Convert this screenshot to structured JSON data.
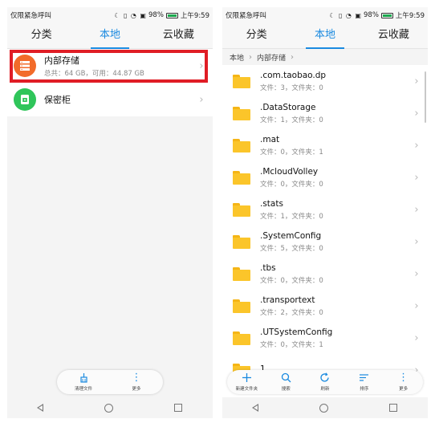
{
  "left_screen": {
    "status": {
      "carrier": "仅限紧急呼叫",
      "battery": "98%",
      "time": "上午9:59"
    },
    "tabs": [
      "分类",
      "本地",
      "云收藏"
    ],
    "storage": [
      {
        "name": "内部存储",
        "detail": "总共：64 GB，可用：44.87 GB",
        "icon": "storage-icon",
        "color": "#f26b2a"
      },
      {
        "name": "保密柜",
        "detail": "",
        "icon": "safe-icon",
        "color": "#2fc55a"
      }
    ],
    "toolbar": [
      {
        "label": "清理文件",
        "icon": "clean-icon"
      },
      {
        "label": "更多",
        "icon": "more-icon"
      }
    ]
  },
  "right_screen": {
    "status": {
      "carrier": "仅限紧急呼叫",
      "battery": "98%",
      "time": "上午9:59"
    },
    "tabs": [
      "分类",
      "本地",
      "云收藏"
    ],
    "breadcrumb": [
      "本地",
      "内部存储"
    ],
    "files": [
      {
        "name": ".com.taobao.dp",
        "meta": "文件：3，文件夹：0"
      },
      {
        "name": ".DataStorage",
        "meta": "文件：1，文件夹：0"
      },
      {
        "name": ".mat",
        "meta": "文件：0，文件夹：1"
      },
      {
        "name": ".McloudVolley",
        "meta": "文件：0，文件夹：0"
      },
      {
        "name": ".stats",
        "meta": "文件：1，文件夹：0"
      },
      {
        "name": ".SystemConfig",
        "meta": "文件：5，文件夹：0"
      },
      {
        "name": ".tbs",
        "meta": "文件：0，文件夹：0"
      },
      {
        "name": ".transportext",
        "meta": "文件：2，文件夹：0"
      },
      {
        "name": ".UTSystemConfig",
        "meta": "文件：0，文件夹：1"
      },
      {
        "name": "1",
        "meta": ""
      }
    ],
    "toolbar": [
      {
        "label": "新建文件夹",
        "icon": "plus-icon"
      },
      {
        "label": "搜索",
        "icon": "search-icon"
      },
      {
        "label": "刷新",
        "icon": "refresh-icon"
      },
      {
        "label": "排序",
        "icon": "sort-icon"
      },
      {
        "label": "更多",
        "icon": "more-icon"
      }
    ]
  },
  "colors": {
    "accent": "#1a8ae0",
    "highlight": "#e01d25",
    "folder": "#fbc52a"
  }
}
